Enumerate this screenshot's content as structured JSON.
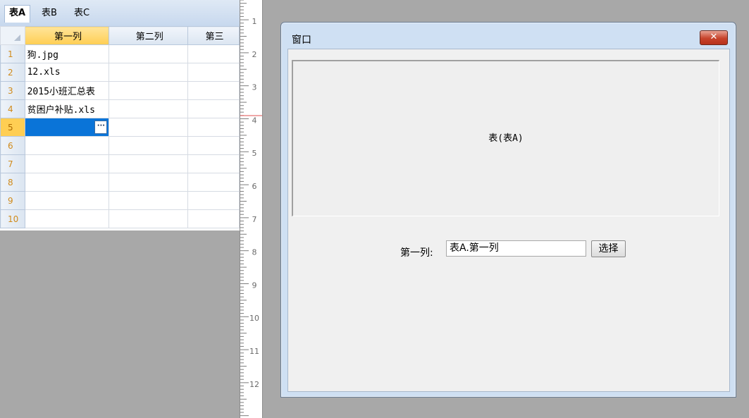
{
  "sheet": {
    "tabs": [
      "表A",
      "表B",
      "表C"
    ],
    "active_tab": 0,
    "columns": [
      "第一列",
      "第二列",
      "第三"
    ],
    "rows": [
      {
        "num": "1",
        "c1": "狗.jpg"
      },
      {
        "num": "2",
        "c1": "12.xls"
      },
      {
        "num": "3",
        "c1": "2015小班汇总表"
      },
      {
        "num": "4",
        "c1": "贫困户补贴.xls"
      },
      {
        "num": "5",
        "c1": ""
      },
      {
        "num": "6",
        "c1": ""
      },
      {
        "num": "7",
        "c1": ""
      },
      {
        "num": "8",
        "c1": ""
      },
      {
        "num": "9",
        "c1": ""
      },
      {
        "num": "10",
        "c1": ""
      }
    ],
    "ellipsis": "···"
  },
  "ruler": {
    "labels": [
      "1",
      "2",
      "3",
      "4",
      "5",
      "6",
      "7",
      "8",
      "9",
      "10",
      "11",
      "12"
    ]
  },
  "window": {
    "title": "窗口",
    "close_icon": "close-x-icon",
    "close_glyph": "✕",
    "table_label": "表(表A)",
    "field_label": "第一列:",
    "field_value": "表A.第一列",
    "choose_button": "选择"
  },
  "colors": {
    "selection": "#0a74d8",
    "header_selected": "#ffce53",
    "close_button": "#c7432b",
    "ruler_marker": "#e05050"
  }
}
